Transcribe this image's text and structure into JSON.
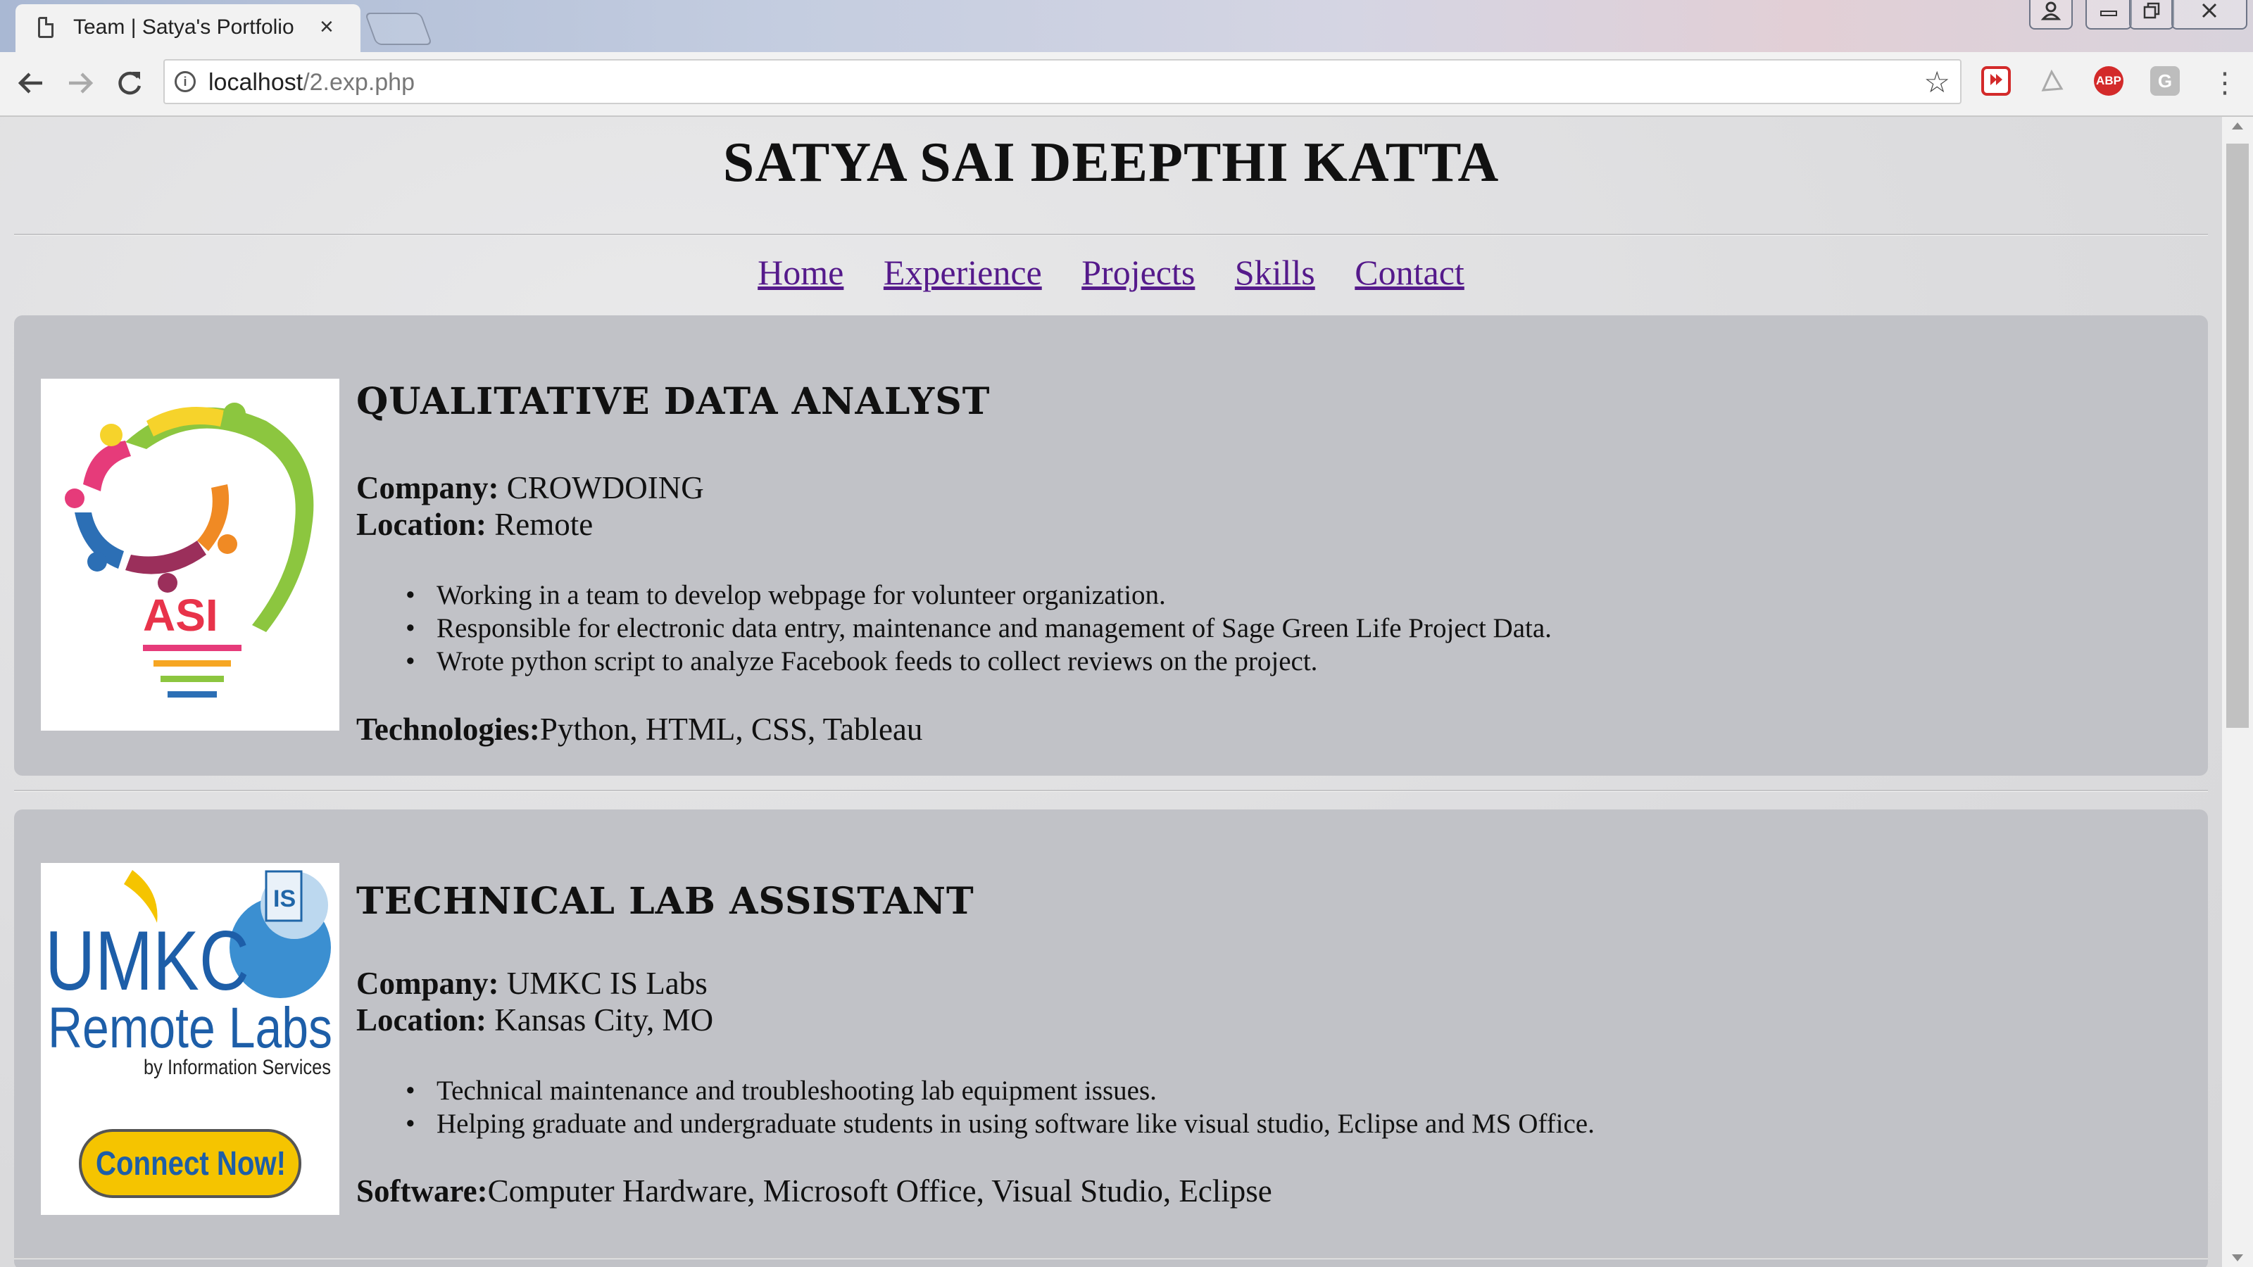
{
  "browser": {
    "tab_title": "Team | Satya's Portfolio",
    "tab_close": "×",
    "url_host": "localhost",
    "url_path": "/2.exp.php",
    "extensions": [
      "abp-badge",
      "g-badge"
    ],
    "ext_abp_label": "ABP",
    "ext_g_label": "G"
  },
  "site": {
    "title": "SATYA SAI DEEPTHI KATTA",
    "nav": [
      "Home",
      "Experience",
      "Projects",
      "Skills",
      "Contact"
    ]
  },
  "jobs": [
    {
      "title": "QUALITATIVE DATA ANALYST",
      "company_label": "Company:",
      "company": " CROWDOING",
      "location_label": "Location:",
      "location": " Remote",
      "bullets": [
        "Working in a team to develop webpage for volunteer organization.",
        "Responsible for electronic data entry, maintenance and management of Sage Green Life Project Data.",
        "Wrote python script to analyze Facebook feeds to collect reviews on the project."
      ],
      "tech_label": "Technologies:",
      "tech": "Python, HTML, CSS, Tableau",
      "logo_text": "ASI"
    },
    {
      "title": "TECHNICAL LAB ASSISTANT",
      "company_label": "Company:",
      "company": " UMKC IS Labs",
      "location_label": "Location:",
      "location": " Kansas City, MO",
      "bullets": [
        "Technical maintenance and troubleshooting lab equipment issues.",
        "Helping graduate and undergraduate students in using software like visual studio, Eclipse and MS Office."
      ],
      "tech_label": "Software:",
      "tech": "Computer Hardware, Microsoft Office, Visual Studio, Eclipse",
      "logo_line1": "UMKC",
      "logo_line2": "Remote Labs",
      "logo_line3": "by Information Services",
      "logo_badge": "IS",
      "logo_button": "Connect Now!"
    }
  ]
}
